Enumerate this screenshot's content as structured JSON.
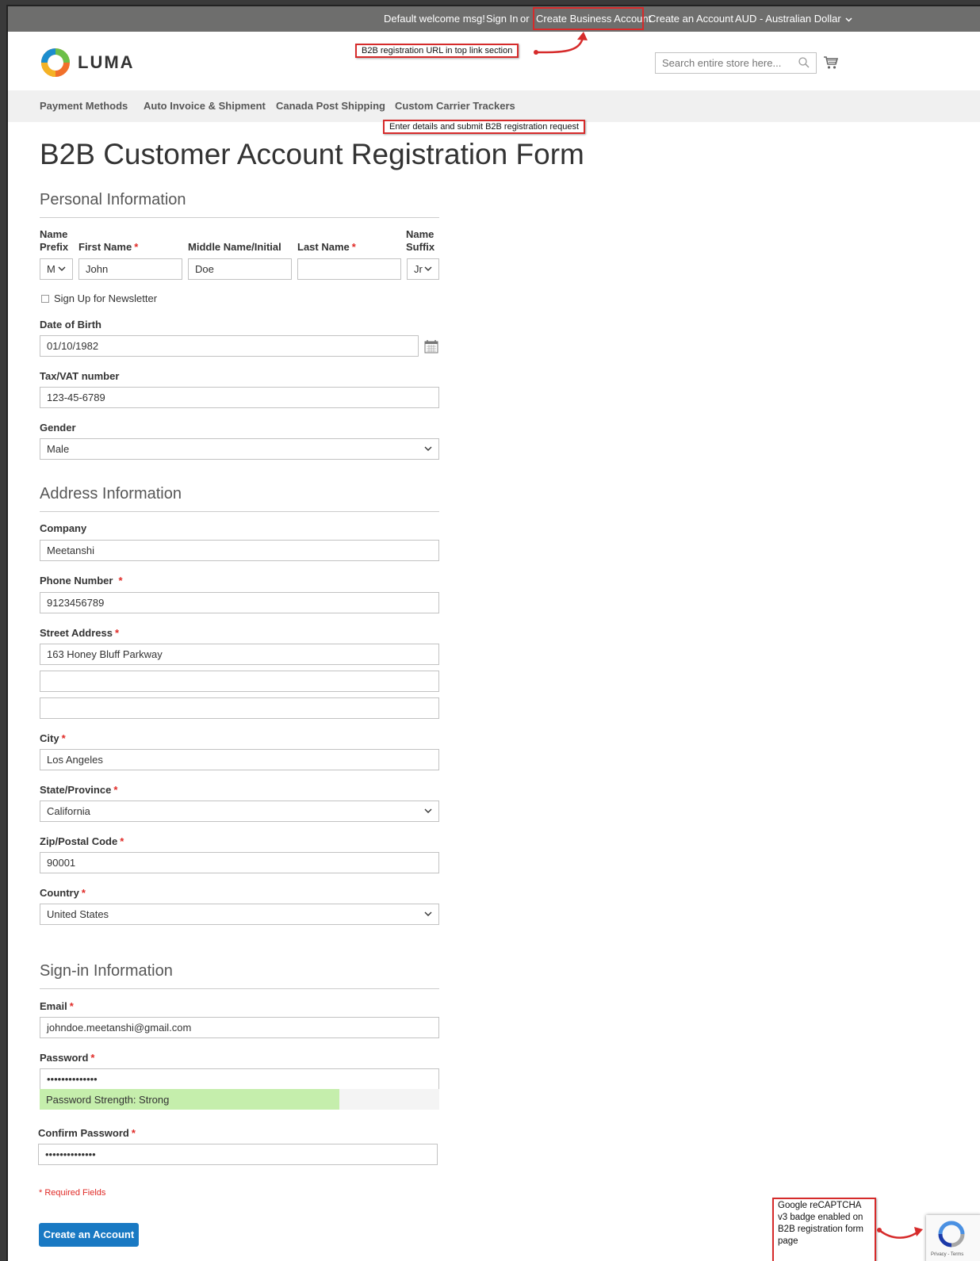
{
  "topbar": {
    "welcome": "Default welcome msg!",
    "sign_in": "Sign In",
    "or": "or",
    "create_business": "Create Business Account",
    "create_account": "Create an Account",
    "currency": "AUD - Australian Dollar"
  },
  "header": {
    "logo": "LUMA",
    "search_placeholder": "Search entire store here..."
  },
  "nav": {
    "items": [
      "Payment Methods",
      "Auto Invoice & Shipment",
      "Canada Post Shipping",
      "Custom Carrier Trackers"
    ]
  },
  "annotations": {
    "top_link": "B2B registration URL in top link section",
    "form": "Enter details and submit B2B registration request",
    "captcha": "Google reCAPTCHA v3 badge enabled on B2B registration form page"
  },
  "page_title": "B2B Customer Account Registration Form",
  "personal": {
    "title": "Personal Information",
    "prefix_label_1": "Name",
    "prefix_label_2": "Prefix",
    "prefix_value": "M",
    "first_name_label": "First Name",
    "first_name_value": "John",
    "middle_name_label": "Middle Name/Initial",
    "middle_name_value": "Doe",
    "last_name_label": "Last Name",
    "last_name_value": "",
    "suffix_label_1": "Name",
    "suffix_label_2": "Suffix",
    "suffix_value": "Jr",
    "newsletter_label": "Sign Up for Newsletter",
    "dob_label": "Date of Birth",
    "dob_value": "01/10/1982",
    "tax_label": "Tax/VAT number",
    "tax_value": "123-45-6789",
    "gender_label": "Gender",
    "gender_value": "Male"
  },
  "address": {
    "title": "Address Information",
    "company_label": "Company",
    "company_value": "Meetanshi",
    "phone_label": "Phone Number",
    "phone_value": "9123456789",
    "street_label": "Street Address",
    "street_value_1": "163 Honey Bluff Parkway",
    "street_value_2": "",
    "street_value_3": "",
    "city_label": "City",
    "city_value": "Los Angeles",
    "state_label": "State/Province",
    "state_value": "California",
    "zip_label": "Zip/Postal Code",
    "zip_value": "90001",
    "country_label": "Country",
    "country_value": "United States"
  },
  "signin": {
    "title": "Sign-in Information",
    "email_label": "Email",
    "email_value": "johndoe.meetanshi@gmail.com",
    "password_label": "Password",
    "password_value": "••••••••••••••",
    "strength_text": "Password Strength: Strong",
    "strength_fraction": 0.75,
    "confirm_label": "Confirm Password",
    "confirm_value": "••••••••••••••"
  },
  "required_note": "* Required Fields",
  "required_mark": "*",
  "submit_label": "Create an Account",
  "captcha_badge_text": "Privacy - Terms",
  "colors": {
    "topbar": "#6e6e6d",
    "accent": "#1979c3",
    "annotation": "#d62b2b",
    "required": "#e02b27",
    "strength": "#c5eeac"
  }
}
